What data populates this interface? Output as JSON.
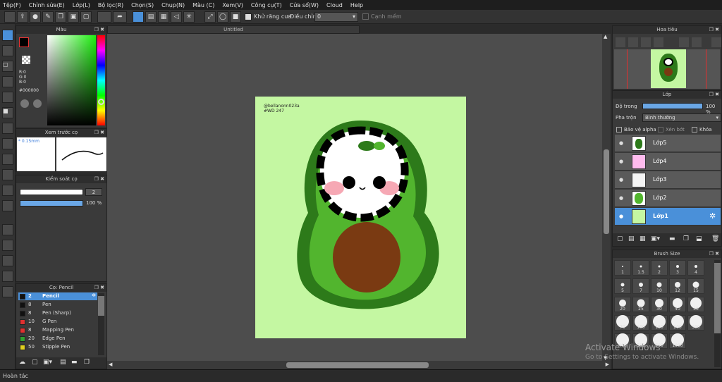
{
  "menu": [
    "Tệp(F)",
    "Chỉnh sửa(E)",
    "Lớp(L)",
    "Bộ lọc(R)",
    "Chọn(S)",
    "Chụp(N)",
    "Màu (C)",
    "Xem(V)",
    "Công cụ(T)",
    "Cửa sổ(W)",
    "Cloud",
    "Help"
  ],
  "toolbar": {
    "antialias_label": "Khử răng cưa",
    "adjust_label": "Điều chỉnh",
    "adjust_value": "0",
    "softedge_label": "Cạnh mềm"
  },
  "document": {
    "title": "Untitled",
    "signature": "@bellanonn023a #WD 247"
  },
  "color_panel": {
    "title": "Màu",
    "r": "R:0",
    "g": "G:0",
    "b": "B:0",
    "hex": "#000000"
  },
  "brush_preview": {
    "title": "Xem trước cọ",
    "size": "* 0.15mm"
  },
  "brush_control": {
    "title": "Kiểm soát cọ",
    "size_value": "2",
    "opacity_value": "100 %"
  },
  "brush_list": {
    "title": "Cọ: Pencil",
    "items": [
      {
        "size": "2",
        "name": "Pencil",
        "color": "#111111"
      },
      {
        "size": "8",
        "name": "Pen",
        "color": "#111111"
      },
      {
        "size": "8",
        "name": "Pen (Sharp)",
        "color": "#111111"
      },
      {
        "size": "10",
        "name": "G Pen",
        "color": "#e03030"
      },
      {
        "size": "8",
        "name": "Mapping Pen",
        "color": "#e03030"
      },
      {
        "size": "20",
        "name": "Edge Pen",
        "color": "#30a030"
      },
      {
        "size": "50",
        "name": "Stipple Pen",
        "color": "#e0d020"
      }
    ]
  },
  "navigator": {
    "title": "Hoa tiêu"
  },
  "layers": {
    "title": "Lớp",
    "opacity_label": "Độ trong",
    "opacity_value": "100 %",
    "blend_label": "Pha trộn",
    "blend_value": "Bình thường",
    "protect_alpha": "Bảo vệ alpha",
    "clipping": "Xén bớt",
    "lock": "Khóa",
    "items": [
      "Lớp5",
      "Lớp4",
      "Lớp3",
      "Lớp2",
      "Lớp1"
    ]
  },
  "brush_size": {
    "title": "Brush Size",
    "sizes": [
      "1",
      "1.5",
      "2",
      "3",
      "4",
      "5",
      "7",
      "10",
      "12",
      "15",
      "20",
      "25",
      "30",
      "40",
      "50",
      "70",
      "100",
      "150",
      "200",
      "300",
      "400",
      "500",
      "700",
      "1000"
    ]
  },
  "status": "Hoàn tác",
  "watermark": {
    "line1": "Activate Windows",
    "line2": "Go to Settings to activate Windows."
  },
  "colors": {
    "canvas_bg": "#c4f7a2",
    "avocado_dark": "#2d7a1a",
    "avocado_light": "#52b52e",
    "pit": "#7a3a12",
    "selected": "#4a90d9"
  }
}
